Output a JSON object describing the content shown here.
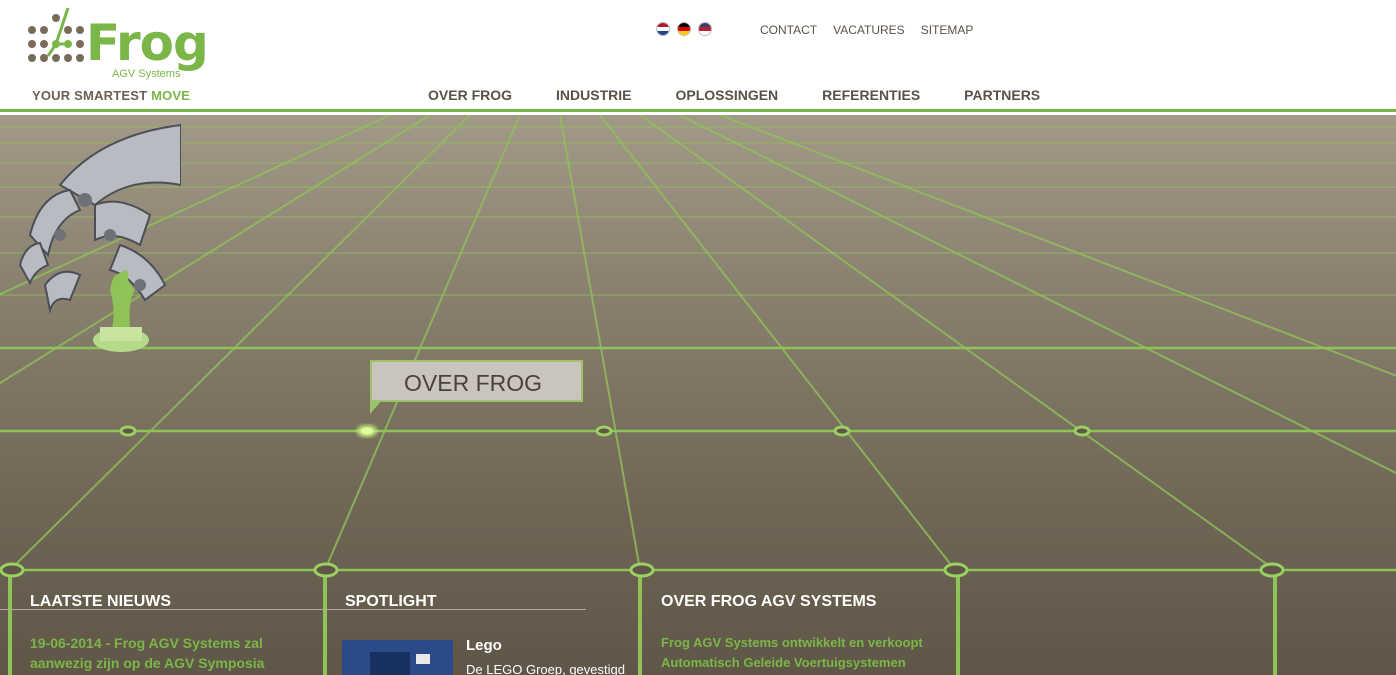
{
  "logo": {
    "word": "Frog",
    "sub": "AGV Systems",
    "tagline_part1": "YOUR SMARTEST ",
    "tagline_part2": "MOVE"
  },
  "language_flags": [
    {
      "icon": "flag-netherlands-icon",
      "colors": [
        "#ae1c28",
        "#ffffff",
        "#21468b"
      ]
    },
    {
      "icon": "flag-germany-icon",
      "colors": [
        "#000000",
        "#dd0000",
        "#ffce00"
      ]
    },
    {
      "icon": "flag-usa-icon",
      "colors": [
        "#b22234",
        "#ffffff",
        "#3c3b6e"
      ]
    }
  ],
  "top_links": [
    "CONTACT",
    "VACATURES",
    "SITEMAP"
  ],
  "main_nav": [
    "OVER FROG",
    "INDUSTRIE",
    "OPLOSSINGEN",
    "REFERENTIES",
    "PARTNERS"
  ],
  "hero": {
    "callout": "OVER FROG"
  },
  "sections": {
    "news": {
      "title": "LAATSTE NIEUWS",
      "line1": "19-06-2014 - Frog AGV Systems zal",
      "line2": "aanwezig zijn op de AGV Symposia"
    },
    "spotlight": {
      "title": "SPOTLIGHT",
      "item_title": "Lego",
      "item_text": "De LEGO Groep, gevestigd"
    },
    "about": {
      "title": "OVER FROG AGV SYSTEMS",
      "line1": "Frog AGV Systems ontwikkelt en verkoopt",
      "line2": "Automatisch Geleide Voertuigsystemen"
    }
  },
  "colors": {
    "brand_green": "#7ab648",
    "nav_text": "#5b5247",
    "hero_bg": "#7a7161"
  }
}
